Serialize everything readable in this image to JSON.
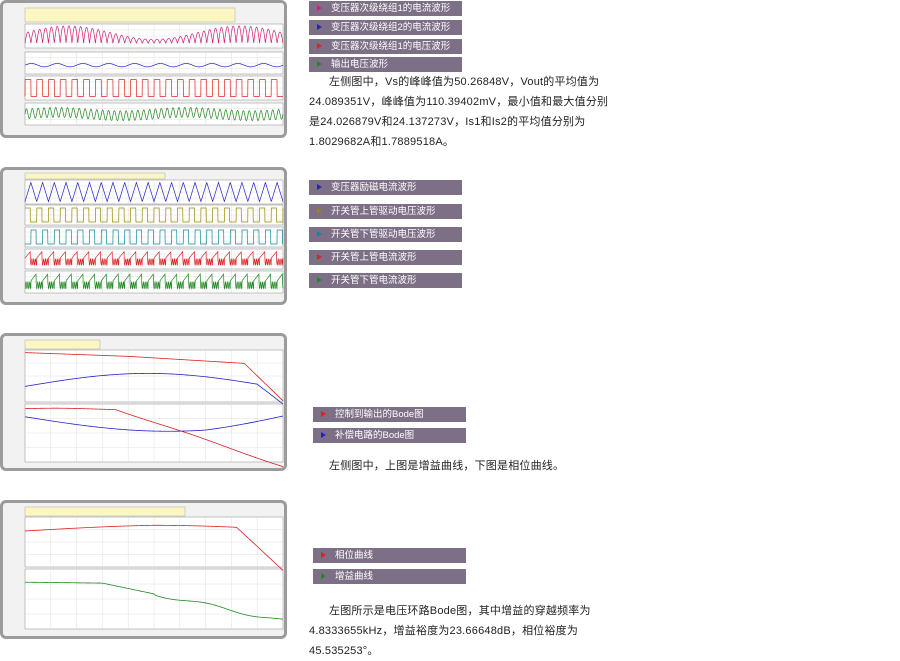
{
  "section1": {
    "legend": [
      {
        "label": "变压器次级绕组1的电流波形",
        "color": "#cc2277"
      },
      {
        "label": "变压器次级绕组2的电流波形",
        "color": "#2222cc"
      },
      {
        "label": "变压器次级绕组1的电压波形",
        "color": "#dd2222"
      },
      {
        "label": "输出电压波形",
        "color": "#228822"
      }
    ],
    "description": "左侧图中，Vs的峰峰值为50.26848V，Vout的平均值为24.089351V，峰峰值为110.39402mV，最小值和最大值分别是24.026879V和24.137273V，Is1和Is2的平均值分别为1.8029682A和1.7889518A。"
  },
  "section2": {
    "legend": [
      {
        "label": "变压器励磁电流波形",
        "color": "#2222cc"
      },
      {
        "label": "开关管上管驱动电压波形",
        "color": "#998800"
      },
      {
        "label": "开关管下管驱动电压波形",
        "color": "#118899"
      },
      {
        "label": "开关管上管电流波形",
        "color": "#dd2222"
      },
      {
        "label": "开关管下管电流波形",
        "color": "#228822"
      }
    ]
  },
  "section3": {
    "legend": [
      {
        "label": "控制到输出的Bode图",
        "color": "#dd2222"
      },
      {
        "label": "补偿电路的Bode图",
        "color": "#2222cc"
      }
    ],
    "description": "左侧图中，上图是增益曲线，下图是相位曲线。"
  },
  "section4": {
    "legend": [
      {
        "label": "相位曲线",
        "color": "#dd2222"
      },
      {
        "label": "增益曲线",
        "color": "#228822"
      }
    ],
    "description": "左图所示是电压环路Bode图，其中增益的穿越频率为4.8333655kHz，增益裕度为23.66648dB，相位裕度为45.535253°。"
  }
}
